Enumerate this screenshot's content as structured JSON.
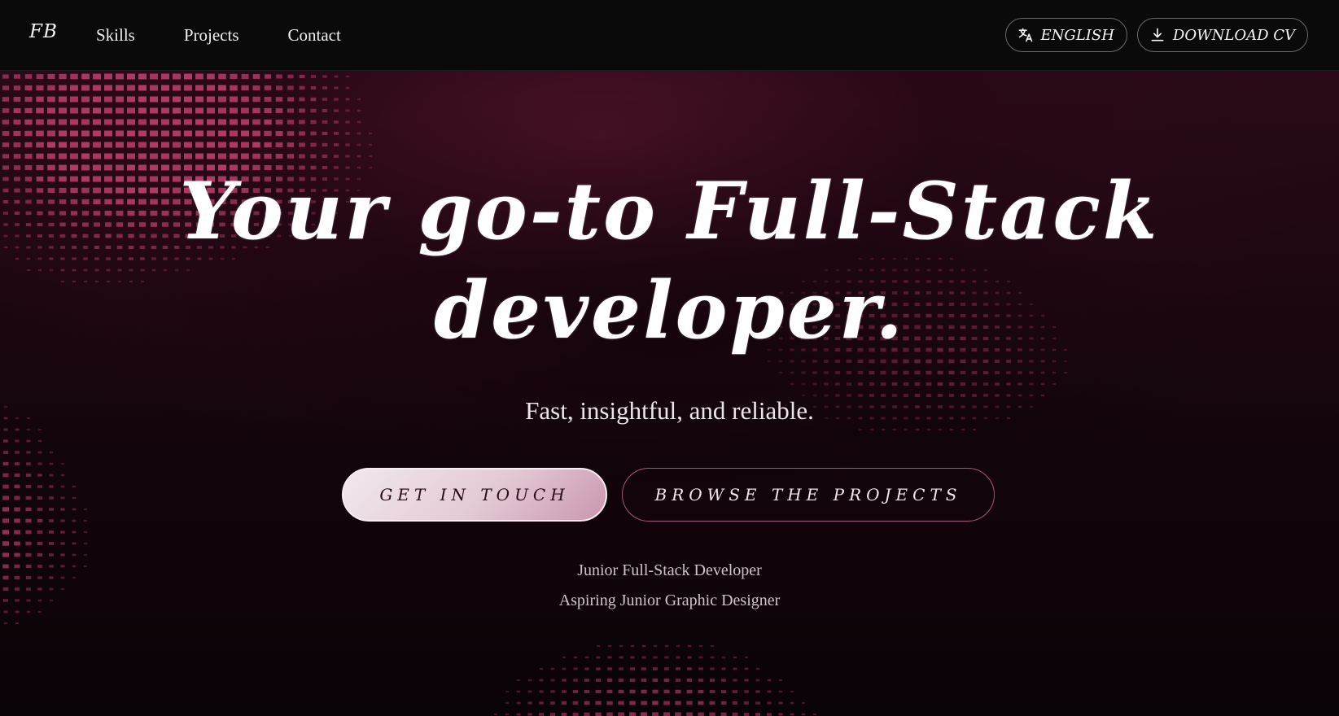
{
  "nav": {
    "logo": "FB",
    "links": [
      {
        "label": "Skills"
      },
      {
        "label": "Projects"
      },
      {
        "label": "Contact"
      }
    ],
    "language_button": {
      "label": "ENGLISH",
      "icon": "translate-icon"
    },
    "cv_button": {
      "label": "DOWNLOAD CV",
      "icon": "download-icon"
    }
  },
  "hero": {
    "headline_line1": "Your go-to Full-Stack",
    "headline_line2": "developer.",
    "subtitle": "Fast, insightful, and reliable.",
    "primary_cta": "GET IN TOUCH",
    "secondary_cta": "BROWSE THE PROJECTS",
    "roles": [
      "Junior Full-Stack Developer",
      "Aspiring Junior Graphic Designer"
    ]
  },
  "colors": {
    "nav_bg": "#0a0a0a",
    "hero_bg": "#2a0a18",
    "pattern_accent": "#c2406f",
    "primary_button_bg": "#e3c9d6",
    "secondary_button_border": "#a4587b"
  }
}
